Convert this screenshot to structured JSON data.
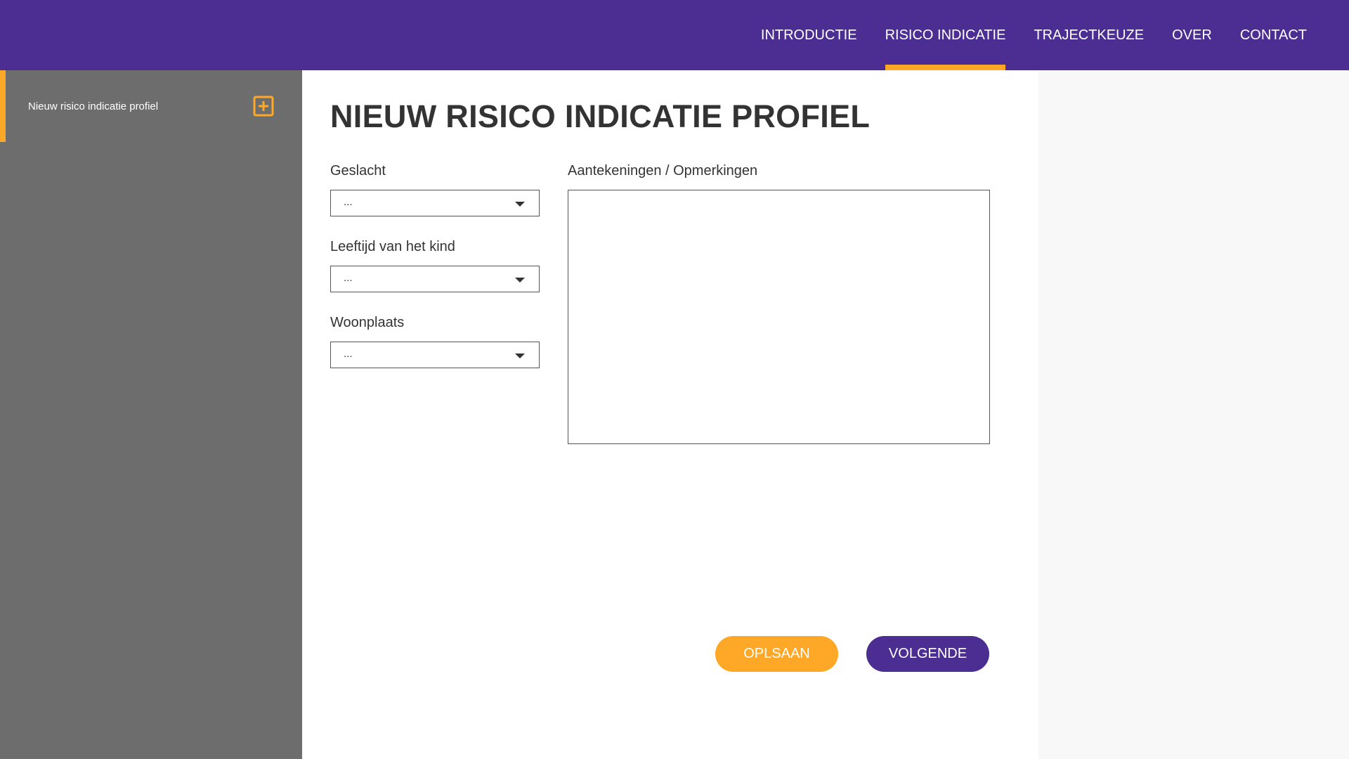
{
  "nav": {
    "items": [
      {
        "label": "INTRODUCTIE"
      },
      {
        "label": "RISICO INDICATIE"
      },
      {
        "label": "TRAJECTKEUZE"
      },
      {
        "label": "OVER"
      },
      {
        "label": "CONTACT"
      }
    ],
    "active": "RISICO INDICATIE"
  },
  "sidebar": {
    "items": [
      {
        "label": "Nieuw risico indicatie profiel",
        "icon": "add-square-icon"
      }
    ]
  },
  "main": {
    "title": "NIEUW RISICO INDICATIE PROFIEL",
    "fields": [
      {
        "label": "Geslacht",
        "value": "..."
      },
      {
        "label": "Leeftijd van het kind",
        "value": "..."
      },
      {
        "label": "Woonplaats",
        "value": "..."
      }
    ],
    "notes": {
      "label": "Aantekeningen / Opmerkingen",
      "value": ""
    },
    "buttons": {
      "save": "OPLSAAN",
      "next": "VOLGENDE"
    }
  },
  "colors": {
    "brand_purple": "#4c2d92",
    "accent_orange": "#ffa726",
    "sidebar_grey": "#6d6d6d"
  }
}
